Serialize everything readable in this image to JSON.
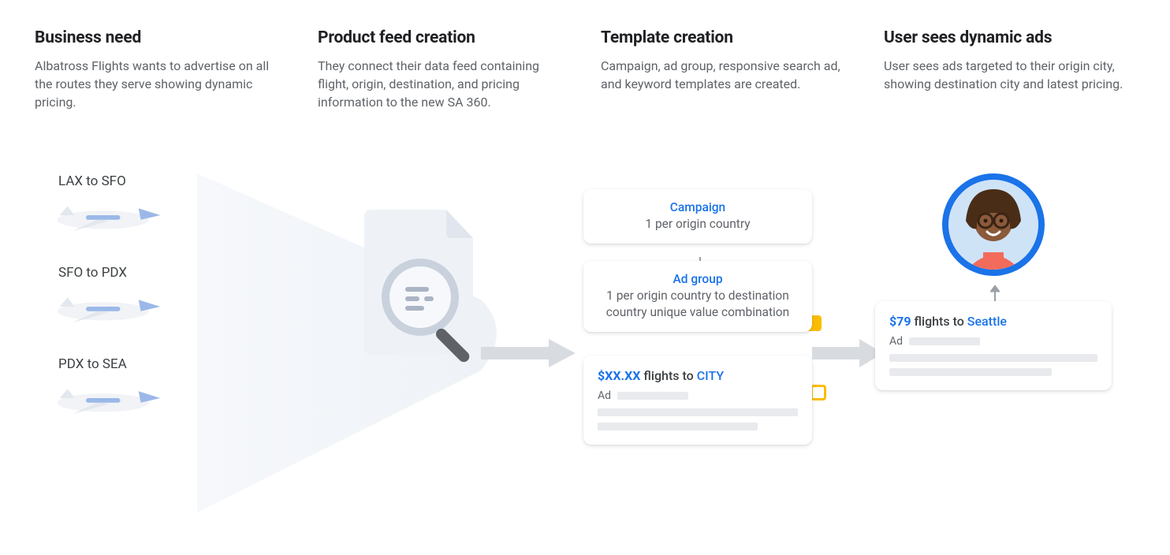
{
  "columns": [
    {
      "title": "Business need",
      "desc": "Albatross Flights wants to advertise on all the routes they serve showing dynamic pricing."
    },
    {
      "title": "Product feed creation",
      "desc": "They connect their data feed containing flight, origin, destination, and pricing information to the new SA 360."
    },
    {
      "title": "Template creation",
      "desc": "Campaign, ad group, responsive search ad, and keyword templates are created."
    },
    {
      "title": "User sees dynamic ads",
      "desc": "User sees ads targeted to their origin city, showing destination city and latest pricing."
    }
  ],
  "routes": [
    "LAX to SFO",
    "SFO to PDX",
    "PDX to SEA"
  ],
  "template_cards": {
    "campaign": {
      "title": "Campaign",
      "sub": "1 per origin country"
    },
    "adgroup": {
      "title": "Ad group",
      "sub": "1 per origin country to destination country unique value combination"
    }
  },
  "template_ad": {
    "price": "$XX.XX",
    "mid": " flights to ",
    "dest": "CITY",
    "ad_label": "Ad"
  },
  "dynamic_ad": {
    "price": "$79",
    "mid": " flights to ",
    "dest": "Seattle",
    "ad_label": "Ad"
  },
  "colors": {
    "blue": "#1a73e8",
    "grey": "#e8eaed",
    "amber": "#fbbc04",
    "text": "#3c4043",
    "muted": "#5f6368"
  }
}
